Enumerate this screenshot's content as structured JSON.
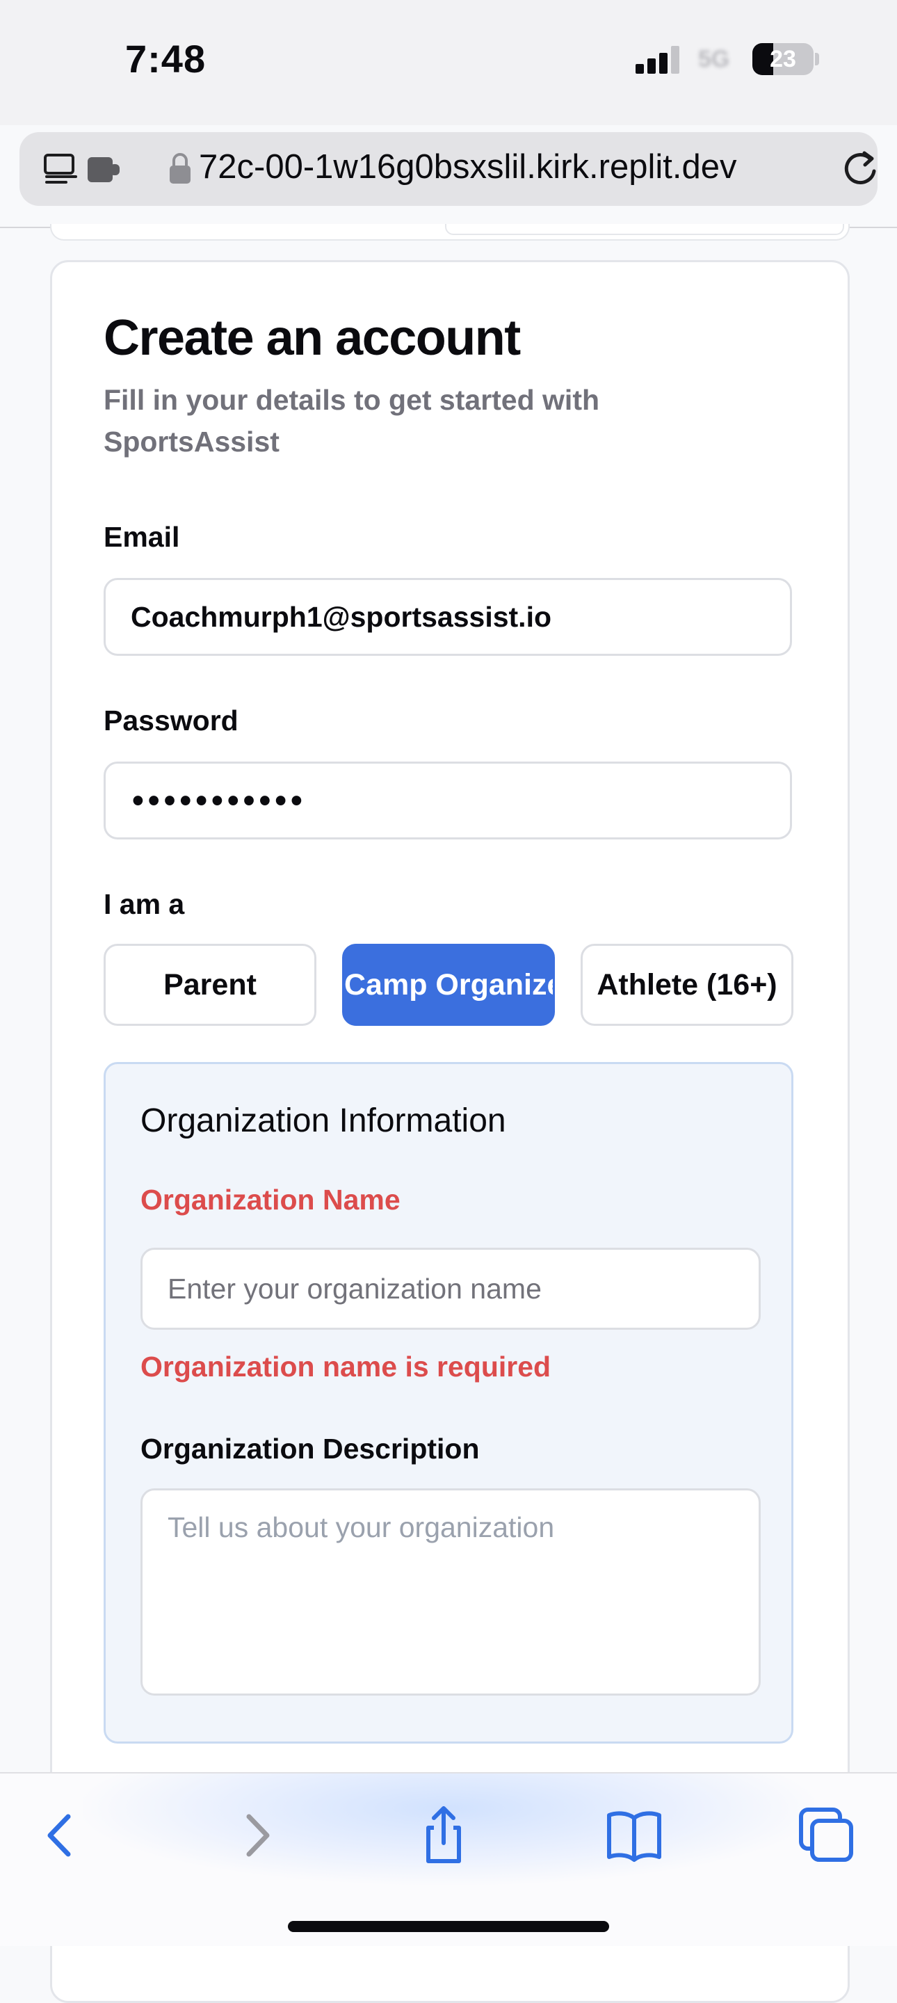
{
  "status_bar": {
    "time": "7:48",
    "network": "5G",
    "battery_level": "23"
  },
  "address_bar": {
    "url": "72c-00-1w16g0bsxslil.kirk.replit.dev",
    "icons": [
      "reader-mode-icon",
      "extension-icon",
      "lock-icon",
      "reload-icon"
    ]
  },
  "form": {
    "title": "Create an account",
    "subtitle": "Fill in your details to get started with SportsAssist",
    "email_label": "Email",
    "email_value": "Coachmurph1@sportsassist.io",
    "password_label": "Password",
    "password_value": "•••••••••••",
    "role_label": "I am a",
    "roles": [
      {
        "label": "Parent",
        "selected": false
      },
      {
        "label": "Camp Organizer",
        "selected": true
      },
      {
        "label": "Athlete (16+)",
        "selected": false
      }
    ]
  },
  "org": {
    "title": "Organization Information",
    "name_label": "Organization Name",
    "name_placeholder": "Enter your organization name",
    "name_error": "Organization name is required",
    "description_label": "Organization Description",
    "description_placeholder": "Tell us about your organization"
  },
  "toolbar": {
    "icons": [
      "back-icon",
      "forward-icon",
      "share-icon",
      "bookmarks-icon",
      "tabs-icon"
    ]
  },
  "colors": {
    "accent": "#3b6fde",
    "error": "#dc4c4c",
    "panel_bg": "#f1f5fb",
    "panel_border": "#c9daf2",
    "toolbar_icon": "#2f6fe4"
  }
}
